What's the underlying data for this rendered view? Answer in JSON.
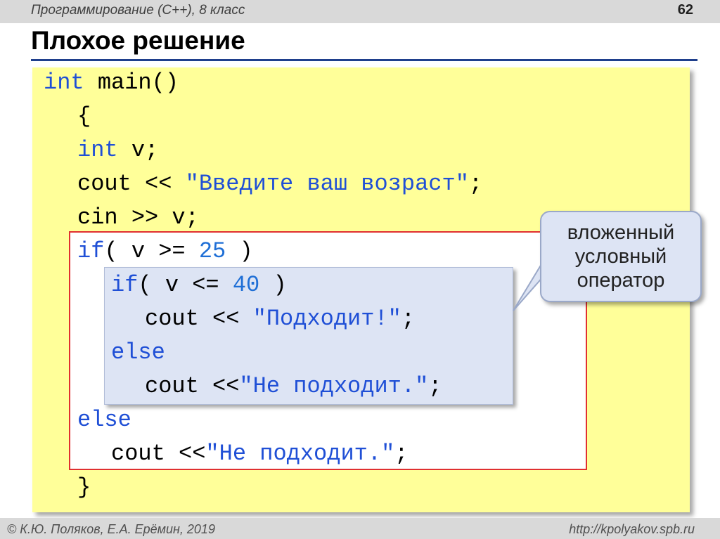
{
  "header": {
    "course": "Программирование (С++), 8 класс",
    "slide_number": "62"
  },
  "title": "Плохое решение",
  "code": {
    "l1": {
      "kw": "int",
      "rest": " main()"
    },
    "l2": {
      "text": "{"
    },
    "l3": {
      "kw": "int",
      "rest": " v;"
    },
    "l4": {
      "a": "cout << ",
      "str": "\"Введите ваш возраст\"",
      "b": ";"
    },
    "l5": {
      "text": "cin >> v;"
    },
    "l6": {
      "kw": "if",
      "a": "( v >= ",
      "num": "25",
      "b": " )"
    },
    "l7": {
      "kw": "if",
      "a": "( v <= ",
      "num": "40",
      "b": " )"
    },
    "l8": {
      "a": "cout << ",
      "str": "\"Подходит!\"",
      "b": ";"
    },
    "l9": {
      "kw": "else"
    },
    "l10": {
      "a": "cout <<",
      "str": "\"Не подходит.\"",
      "b": ";"
    },
    "l11": {
      "kw": "else"
    },
    "l12": {
      "a": "cout <<",
      "str": "\"Не подходит.\"",
      "b": ";"
    },
    "l13": {
      "text": "}"
    }
  },
  "callout": {
    "line1": "вложенный",
    "line2": "условный",
    "line3": "оператор"
  },
  "footer": {
    "authors": "© К.Ю. Поляков, Е.А. Ерёмин, 2019",
    "url": "http://kpolyakov.spb.ru"
  },
  "colors": {
    "keyword": "#1f4fd6",
    "panel_bg": "#ffff99",
    "frame": "#e03030",
    "inner_bg": "#dde4f4",
    "title_rule": "#1f3f8c"
  }
}
